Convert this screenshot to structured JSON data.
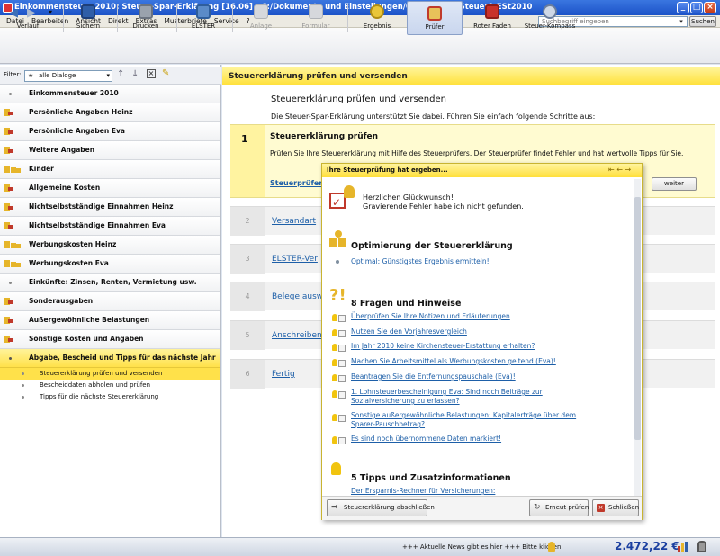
{
  "window": {
    "title": "Einkommensteuer 2010: Steuer-Spar-Erklärung [16.06] - C:/Dokumente und Einstellungen/G...../MusterSteuer1.ESt2010"
  },
  "menu": [
    "Datei",
    "Bearbeiten",
    "Ansicht",
    "Direkt",
    "Extras",
    "Musterbriefe",
    "Service",
    "?"
  ],
  "search": {
    "placeholder": "Suchbegriff eingeben",
    "button": "Suchen"
  },
  "toolbar": {
    "verlauf": "Verlauf",
    "sichern": "Sichern",
    "drucken": "Drucken",
    "elster": "ELSTER",
    "anlage": "Anlage",
    "formular": "Formular",
    "ergebnis": "Ergebnis",
    "pruefer": "Prüfer",
    "roter_faden": "Roter Faden",
    "steuer_kompass": "Steuer-Kompass"
  },
  "filter": {
    "label": "Filter:",
    "value": "alle Dialoge"
  },
  "nav": [
    "Einkommensteuer 2010",
    "Persönliche Angaben Heinz",
    "Persönliche Angaben Eva",
    "Weitere Angaben",
    "Kinder",
    "Allgemeine Kosten",
    "Nichtselbstständige Einnahmen Heinz",
    "Nichtselbstständige Einnahmen Eva",
    "Werbungskosten Heinz",
    "Werbungskosten Eva",
    "Einkünfte: Zinsen, Renten, Vermietung usw.",
    "Sonderausgaben",
    "Außergewöhnliche Belastungen",
    "Sonstige Kosten und Angaben",
    "Abgabe, Bescheid und Tipps für das nächste Jahr"
  ],
  "nav_sub": [
    "Steuererklärung prüfen und versenden",
    "Bescheiddaten abholen und prüfen",
    "Tipps für die nächste Steuererklärung"
  ],
  "main": {
    "header": "Steuererklärung prüfen und versenden",
    "heading": "Steuererklärung prüfen und versenden",
    "intro": "Die Steuer-Spar-Erklärung unterstützt Sie dabei. Führen Sie einfach folgende Schritte aus:",
    "step1": {
      "num": "1",
      "title": "Steuererklärung prüfen",
      "text": "Prüfen Sie Ihre Steuererklärung mit Hilfe des Steuerprüfers. Der Steuerprüfer findet Fehler und hat wertvolle Tipps für Sie.",
      "link": "Steuerprüfer",
      "button": "weiter"
    },
    "steps": [
      {
        "num": "2",
        "text": "Versandart"
      },
      {
        "num": "3",
        "text": "ELSTER-Ver"
      },
      {
        "num": "4",
        "text": "Belege ausw"
      },
      {
        "num": "5",
        "text": "Anschreiben"
      },
      {
        "num": "6",
        "text": "Fertig"
      }
    ]
  },
  "popup": {
    "title": "Ihre Steuerprüfung hat ergeben...",
    "congrats": "Herzlichen Glückwunsch!",
    "congrats_sub": "Gravierende Fehler habe ich nicht gefunden.",
    "opt_heading": "Optimierung der Steuererklärung",
    "opt_link": "Optimal: Günstigstes Ergebnis ermitteln!",
    "questions_heading": "8 Fragen und Hinweise",
    "questions": [
      "Überprüfen Sie Ihre Notizen und Erläuterungen",
      "Nutzen Sie den Vorjahresvergleich",
      "Im Jahr 2010 keine Kirchensteuer-Erstattung erhalten?",
      "Machen Sie Arbeitsmittel als Werbungskosten geltend (Eva)!",
      "Beantragen Sie die Entfernungspauschale (Eva)!",
      "1. Lohnsteuerbescheinigung Eva: Sind noch Beiträge zur",
      "Sozialversicherung zu erfassen?",
      "Sonstige außergewöhnliche Belastungen: Kapitalerträge über dem",
      "Sparer-Pauschbetrag?",
      "Es sind noch übernommene Daten markiert!"
    ],
    "tips_heading": "5 Tipps und Zusatzinformationen",
    "tips_first": "Der Ersparnis-Rechner für Versicherungen:",
    "btn_finish": "Steuererklärung abschließen",
    "btn_recheck": "Erneut prüfen",
    "btn_close": "Schließen"
  },
  "status": {
    "news": "+++ Aktuelle News gibt es hier +++ Bitte klicken",
    "amount": "2.472,22 €"
  },
  "colors": {
    "accent_yellow": "#ffe14a",
    "link_blue": "#1d5fa8",
    "title_blue": "#1c53c8",
    "amount_blue": "#1a3fa0"
  }
}
